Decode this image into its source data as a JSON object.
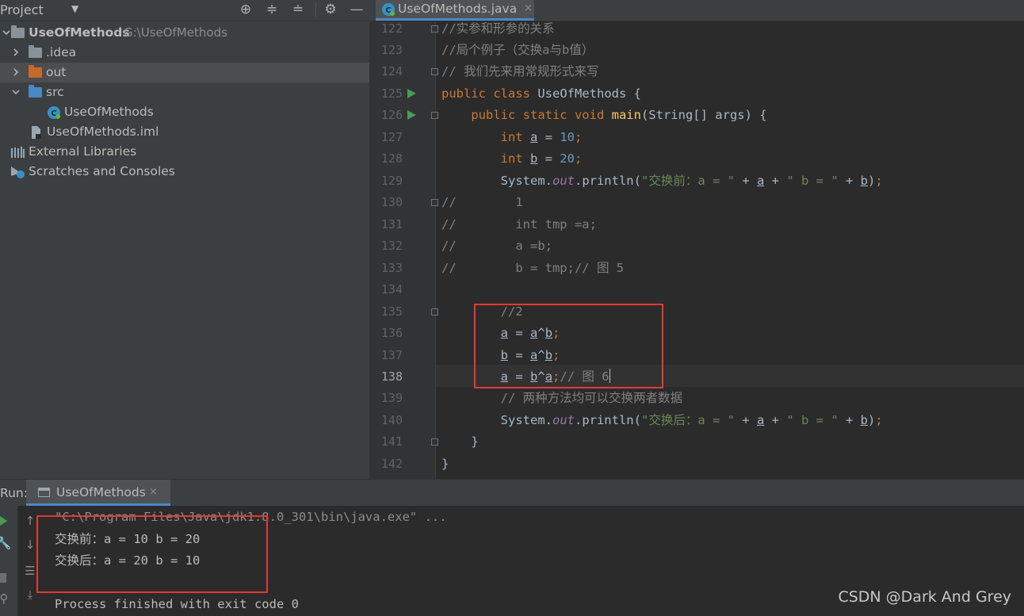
{
  "project_panel": {
    "title": "Project",
    "header_icons": [
      "crosshair-icon",
      "expand-all-icon",
      "collapse-all-icon",
      "gear-icon",
      "minimize-icon"
    ],
    "tree": [
      {
        "label": "UseOfMethods",
        "path": "G:\\UseOfMethods",
        "icon": "module-folder-icon"
      },
      {
        "label": ".idea",
        "icon": "folder-icon"
      },
      {
        "label": "out",
        "icon": "excluded-folder-icon"
      },
      {
        "label": "src",
        "icon": "source-folder-icon"
      },
      {
        "label": "UseOfMethods",
        "icon": "java-class-icon"
      },
      {
        "label": "UseOfMethods.iml",
        "icon": "iml-file-icon"
      },
      {
        "label": "External Libraries",
        "icon": "libraries-icon"
      },
      {
        "label": "Scratches and Consoles",
        "icon": "scratches-icon"
      }
    ]
  },
  "editor_tab": {
    "label": "UseOfMethods.java",
    "close": "×"
  },
  "editor": {
    "line_numbers": [
      "122",
      "123",
      "124",
      "125",
      "126",
      "127",
      "128",
      "129",
      "130",
      "131",
      "132",
      "133",
      "134",
      "135",
      "136",
      "137",
      "138",
      "139",
      "140",
      "141",
      "142"
    ],
    "current_line": "138",
    "lines": [
      "//实参和形参的关系",
      "//局个例子（交换a与b值）",
      "// 我们先来用常规形式来写",
      "public class UseOfMethods {",
      "    public static void main(String[] args) {",
      "        int a = 10;",
      "        int b = 20;",
      "        System.out.println(\"交换前：a = \" + a + \" b = \" + b);",
      "//        1",
      "//        int tmp =a;",
      "//        a =b;",
      "//        b = tmp;// 图 5",
      "",
      "        //2",
      "        a = a^b;",
      "        b = a^b;",
      "        a = b^a;// 图 6",
      "        // 两种方法均可以交换两者数据",
      "        System.out.println(\"交换后：a = \" + a + \" b = \" + b);",
      "    }",
      "}"
    ]
  },
  "run_panel": {
    "label": "Run:",
    "tab_label": "UseOfMethods",
    "tab_close": "×",
    "console": [
      "\"C:\\Program Files\\Java\\jdk1.8.0_301\\bin\\java.exe\" ...",
      "交换前：a = 10 b = 20",
      "交换后：a = 20 b = 10",
      "",
      "Process finished with exit code 0"
    ]
  },
  "watermark": "CSDN @Dark And Grey",
  "colors": {
    "accent": "#4a88c7",
    "highlight_box": "#e53935",
    "keyword": "#cc7832",
    "string": "#6a8759",
    "number": "#6897bb",
    "comment": "#808080",
    "run_green": "#499c54"
  }
}
